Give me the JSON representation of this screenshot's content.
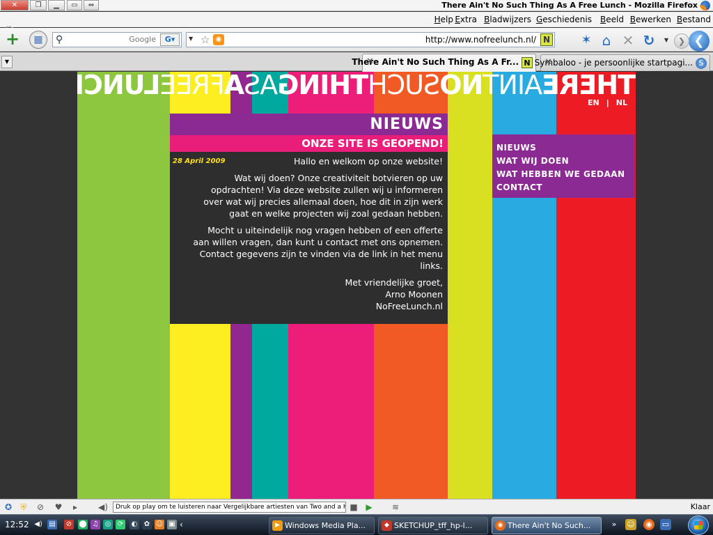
{
  "window": {
    "title": "There Ain't No Such Thing As A Free Lunch - Mozilla Firefox",
    "controls": {
      "minimize": "▁",
      "maximize": "❐",
      "close": "✕"
    }
  },
  "menubar": {
    "items": [
      "Bestand",
      "Bewerken",
      "Beeld",
      "Geschiedenis",
      "Bladwijzers",
      "Extra",
      "Help"
    ]
  },
  "navbar": {
    "url": "http://www.nofreelunch.nl/",
    "site_icon_letter": "N",
    "search_placeholder": "Google",
    "search_engine_letter": "G",
    "icons": {
      "back": "back-arrow-icon",
      "forward": "forward-arrow-icon",
      "reload": "reload-icon",
      "stop": "stop-icon",
      "home": "home-icon",
      "rss": "rss-icon",
      "bookmark": "star-icon"
    }
  },
  "tabs": [
    {
      "title": "There Ain't No Such Thing As A Fr...",
      "active": true,
      "favicon": "N"
    },
    {
      "title": "Symbaloo - je persoonlijke startpagi...",
      "active": false,
      "favicon": "S"
    }
  ],
  "site": {
    "title_parts": [
      {
        "text": "THERE",
        "weight": "bold"
      },
      {
        "text": "AINT",
        "weight": "thin"
      },
      {
        "text": "NO",
        "weight": "bold"
      },
      {
        "text": "SUCH",
        "weight": "thin"
      },
      {
        "text": "THING",
        "weight": "bold"
      },
      {
        "text": "AS",
        "weight": "thin"
      },
      {
        "text": "A",
        "weight": "bold"
      },
      {
        "text": "FREE",
        "weight": "thin"
      },
      {
        "text": "LUNCH",
        "weight": "bold"
      }
    ],
    "languages": [
      "NL",
      "|",
      "EN"
    ],
    "stripe_colors": [
      "#8dc63f",
      "#fcee21",
      "#92278f",
      "#00a99d",
      "#ed1e79",
      "#f15a24",
      "#d9e021",
      "#29abe2",
      "#ed1c24"
    ],
    "nav": [
      "NIEUWS",
      "WAT WIJ DOEN",
      "WAT HEBBEN WE GEDAAN",
      "CONTACT"
    ],
    "section_title": "NIEUWS",
    "post": {
      "title": "ONZE SITE IS GEOPEND!",
      "date": "28 April 2009",
      "paragraphs": [
        "Hallo en welkom op onze website!",
        "Wat wij doen? Onze creativiteit botvieren op uw opdrachten! Via deze website zullen wij u informeren over wat wij precies allemaal doen, hoe dit in zijn werk gaat en welke projecten wij zoal gedaan hebben.",
        "Mocht u uiteindelijk nog vragen hebben of een offerte aan willen vragen, dan kunt u contact met ons opnemen. Contact gegevens zijn te vinden via de link in het menu links."
      ],
      "signoff": [
        "Met vriendelijke groet,",
        "Arno Moonen",
        "NoFreeLunch.nl"
      ]
    }
  },
  "statusbar": {
    "status": "Klaar",
    "media_text": "Druk op play om te luisteren naar Vergelijkbare artiesten van Two and a Half Each"
  },
  "taskbar": {
    "clock": "12:52",
    "tasks": [
      {
        "label": "There Ain't No Such...",
        "active": true,
        "icon": "firefox-icon"
      },
      {
        "label": "SKETCHUP_tff_hp-l...",
        "active": false,
        "icon": "sketchup-icon"
      },
      {
        "label": "Windows Media Pla...",
        "active": false,
        "icon": "media-player-icon"
      }
    ]
  }
}
